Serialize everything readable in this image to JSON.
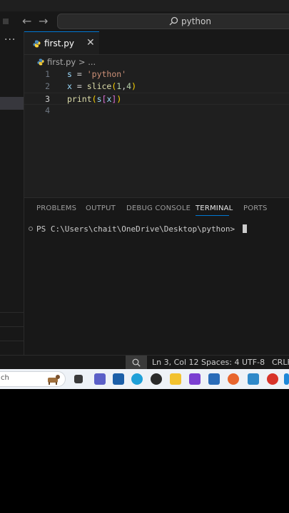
{
  "titlebar": {
    "search_text": "python"
  },
  "tab": {
    "label": "first.py"
  },
  "breadcrumb": {
    "file": "first.py",
    "sep": ">",
    "more": "..."
  },
  "editor": {
    "lines": [
      {
        "num": "1",
        "code": "s = 'python'"
      },
      {
        "num": "2",
        "code": "x = slice(1,4)"
      },
      {
        "num": "3",
        "code": "print(s[x])"
      },
      {
        "num": "4",
        "code": ""
      }
    ]
  },
  "panel": {
    "tabs": [
      "PROBLEMS",
      "OUTPUT",
      "DEBUG CONSOLE",
      "TERMINAL",
      "PORTS"
    ],
    "active_tab": "TERMINAL",
    "prompt": "PS C:\\Users\\chait\\OneDrive\\Desktop\\python> "
  },
  "statusbar": {
    "position": "Ln 3, Col 12",
    "spaces": "Spaces: 4",
    "encoding": "UTF-8",
    "eol": "CRLF"
  },
  "taskbar": {
    "search_placeholder": "ch",
    "icons": [
      "taskview-icon",
      "teams-icon",
      "dell-icon",
      "edge-icon",
      "chrome-icon",
      "file-explorer-icon",
      "clapper-icon",
      "store-icon",
      "firefox-icon",
      "notepad-icon",
      "wps-icon",
      "vscode-icon"
    ]
  },
  "colors": {
    "accent": "#0078d4",
    "editor_bg": "#1f1f1f",
    "panel_bg": "#181818"
  }
}
